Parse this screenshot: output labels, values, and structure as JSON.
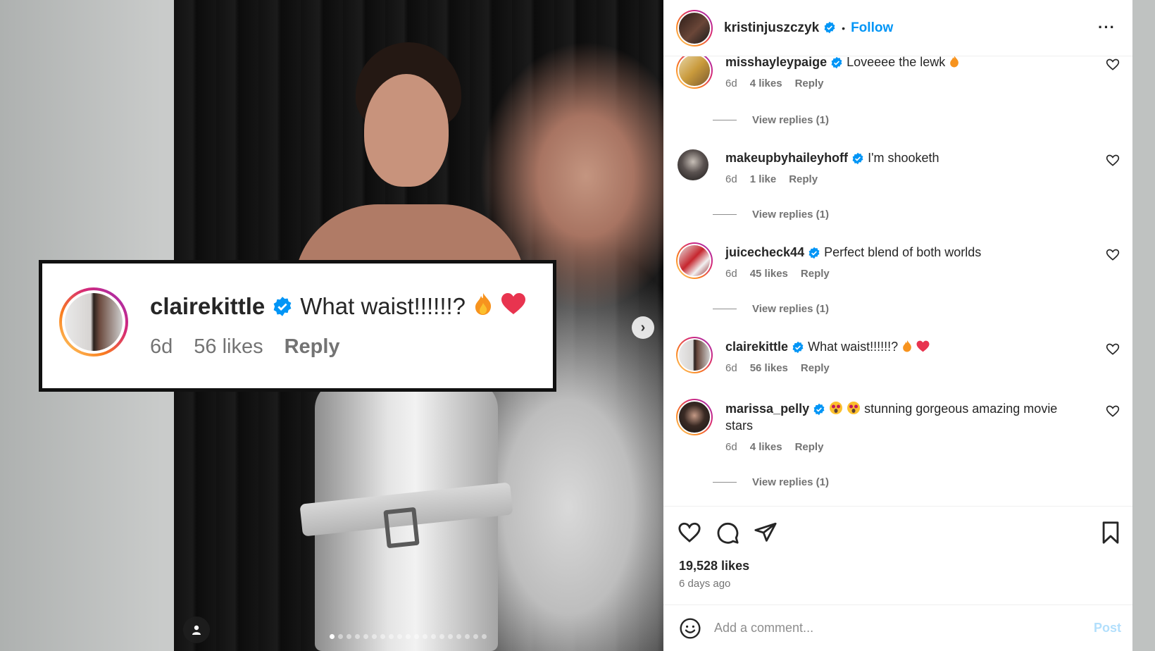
{
  "header": {
    "username": "kristinjuszczyk",
    "separator": "•",
    "follow_label": "Follow",
    "more_label": "···"
  },
  "callout": {
    "username": "clairekittle",
    "text": "What waist!!!!!!?",
    "emojis": [
      "fire",
      "heart"
    ],
    "time": "6d",
    "likes": "56 likes",
    "reply": "Reply"
  },
  "comments": [
    {
      "username": "misshayleypaige",
      "text": "Loveeee the lewk",
      "emoji": "fire",
      "time": "6d",
      "likes": "4 likes",
      "reply": "Reply",
      "view_replies": "View replies (1)"
    },
    {
      "username": "makeupbyhaileyhoff",
      "text": "I'm shooketh",
      "time": "6d",
      "likes": "1 like",
      "reply": "Reply",
      "view_replies": "View replies (1)"
    },
    {
      "username": "juicecheck44",
      "text": "Perfect blend of both worlds",
      "time": "6d",
      "likes": "45 likes",
      "reply": "Reply",
      "view_replies": "View replies (1)"
    },
    {
      "username": "clairekittle",
      "text": "What waist!!!!!!?",
      "emoji": "fire heart",
      "time": "6d",
      "likes": "56 likes",
      "reply": "Reply"
    },
    {
      "username": "marissa_pelly",
      "text": "stunning gorgeous amazing movie stars",
      "emoji": "starstruck x2",
      "time": "6d",
      "likes": "4 likes",
      "reply": "Reply",
      "view_replies": "View replies (1)"
    }
  ],
  "post": {
    "likes": "19,528 likes",
    "time_ago": "6 days ago"
  },
  "add_comment": {
    "placeholder": "Add a comment...",
    "post_label": "Post"
  },
  "carousel": {
    "total_slides": 19,
    "active_slide": 1
  },
  "colors": {
    "follow_blue": "#0095f6",
    "verified_blue": "#0095f6",
    "post_disabled": "#b2dffc"
  }
}
